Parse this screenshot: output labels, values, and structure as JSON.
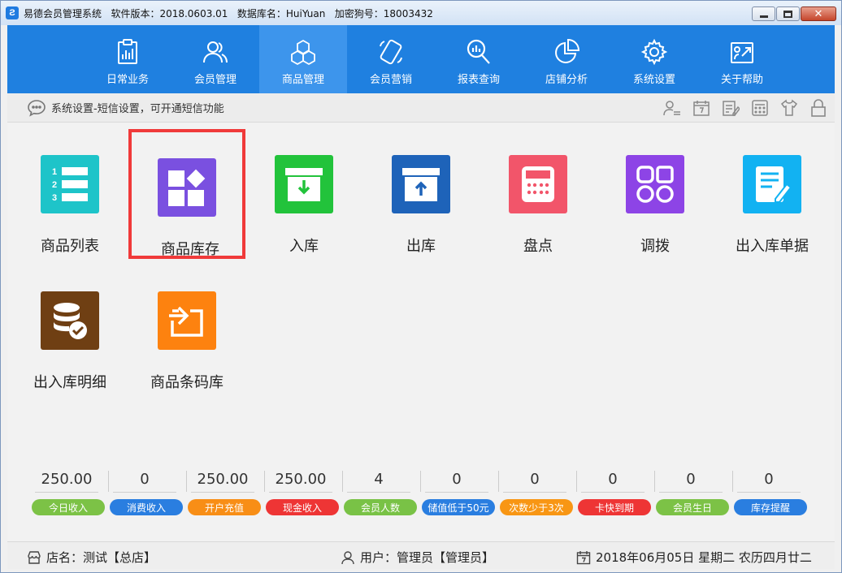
{
  "window": {
    "title": "易德会员管理系统   软件版本：2018.0603.01   数据库名：HuiYuan   加密狗号：18003432",
    "app_icon_glyph": "Ƨ"
  },
  "nav": {
    "items": [
      {
        "label": "日常业务",
        "icon": "clipboard-chart-icon"
      },
      {
        "label": "会员管理",
        "icon": "users-icon"
      },
      {
        "label": "商品管理",
        "icon": "cubes-icon",
        "active": true
      },
      {
        "label": "会员营销",
        "icon": "phone-icon"
      },
      {
        "label": "报表查询",
        "icon": "search-chart-icon"
      },
      {
        "label": "店铺分析",
        "icon": "pie-chart-icon"
      },
      {
        "label": "系统设置",
        "icon": "gear-icon"
      },
      {
        "label": "关于帮助",
        "icon": "help-icon"
      }
    ]
  },
  "infobar": {
    "message": "系统设置-短信设置，可开通短信功能"
  },
  "tiles": [
    {
      "label": "商品列表",
      "color": "#1ec4c9",
      "icon": "numbered-list-icon"
    },
    {
      "label": "商品库存",
      "color": "#7a50e0",
      "icon": "blocks-icon",
      "selected": true
    },
    {
      "label": "入库",
      "color": "#22c33b",
      "icon": "inbox-in-icon"
    },
    {
      "label": "出库",
      "color": "#1e63b9",
      "icon": "inbox-out-icon"
    },
    {
      "label": "盘点",
      "color": "#f2556a",
      "icon": "calculator-icon"
    },
    {
      "label": "调拨",
      "color": "#8d44e6",
      "icon": "four-squares-icon"
    },
    {
      "label": "出入库单据",
      "color": "#12b2f2",
      "icon": "document-edit-icon"
    },
    {
      "label": "出入库明细",
      "color": "#6f3f13",
      "icon": "database-check-icon"
    },
    {
      "label": "商品条码库",
      "color": "#fd820f",
      "icon": "barcode-folder-icon"
    }
  ],
  "stats": [
    {
      "value": "250.00",
      "label": "今日收入",
      "color": "#7cc246"
    },
    {
      "value": "0",
      "label": "消费收入",
      "color": "#2a7ee0"
    },
    {
      "value": "250.00",
      "label": "开户充值",
      "color": "#f88e16"
    },
    {
      "value": "250.00",
      "label": "现金收入",
      "color": "#ee3535"
    },
    {
      "value": "4",
      "label": "会员人数",
      "color": "#79c246"
    },
    {
      "value": "0",
      "label": "储值低于50元",
      "color": "#2a7ee0"
    },
    {
      "value": "0",
      "label": "次数少于3次",
      "color": "#f89614"
    },
    {
      "value": "0",
      "label": "卡快到期",
      "color": "#ee3535"
    },
    {
      "value": "0",
      "label": "会员生日",
      "color": "#7cc246"
    },
    {
      "value": "0",
      "label": "库存提醒",
      "color": "#2a7ee0"
    }
  ],
  "statusbar": {
    "store": "店名：测试【总店】",
    "user": "用户：管理员【管理员】",
    "date": "2018年06月05日 星期二 农历四月廿二"
  }
}
